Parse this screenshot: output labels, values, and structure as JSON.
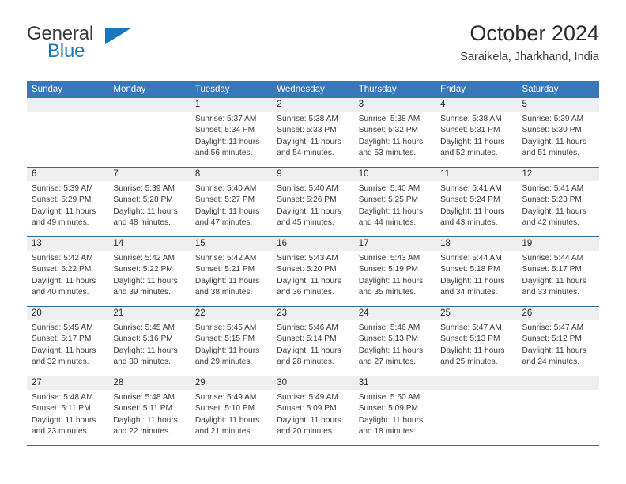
{
  "brand": {
    "name_part1": "General",
    "name_part2": "Blue",
    "flag_icon": "triangle-flag-icon",
    "accent_color": "#1878be",
    "text_color": "#3a3a3a"
  },
  "header": {
    "month_title": "October 2024",
    "location": "Saraikela, Jharkhand, India"
  },
  "calendar": {
    "header_color": "#3878b8",
    "separator_color": "#2e6da4",
    "day_band_color": "#efefef",
    "weekdays": [
      "Sunday",
      "Monday",
      "Tuesday",
      "Wednesday",
      "Thursday",
      "Friday",
      "Saturday"
    ],
    "weeks": [
      [
        {
          "day": "",
          "lines": []
        },
        {
          "day": "",
          "lines": []
        },
        {
          "day": "1",
          "lines": [
            "Sunrise: 5:37 AM",
            "Sunset: 5:34 PM",
            "Daylight: 11 hours",
            "and 56 minutes."
          ]
        },
        {
          "day": "2",
          "lines": [
            "Sunrise: 5:38 AM",
            "Sunset: 5:33 PM",
            "Daylight: 11 hours",
            "and 54 minutes."
          ]
        },
        {
          "day": "3",
          "lines": [
            "Sunrise: 5:38 AM",
            "Sunset: 5:32 PM",
            "Daylight: 11 hours",
            "and 53 minutes."
          ]
        },
        {
          "day": "4",
          "lines": [
            "Sunrise: 5:38 AM",
            "Sunset: 5:31 PM",
            "Daylight: 11 hours",
            "and 52 minutes."
          ]
        },
        {
          "day": "5",
          "lines": [
            "Sunrise: 5:39 AM",
            "Sunset: 5:30 PM",
            "Daylight: 11 hours",
            "and 51 minutes."
          ]
        }
      ],
      [
        {
          "day": "6",
          "lines": [
            "Sunrise: 5:39 AM",
            "Sunset: 5:29 PM",
            "Daylight: 11 hours",
            "and 49 minutes."
          ]
        },
        {
          "day": "7",
          "lines": [
            "Sunrise: 5:39 AM",
            "Sunset: 5:28 PM",
            "Daylight: 11 hours",
            "and 48 minutes."
          ]
        },
        {
          "day": "8",
          "lines": [
            "Sunrise: 5:40 AM",
            "Sunset: 5:27 PM",
            "Daylight: 11 hours",
            "and 47 minutes."
          ]
        },
        {
          "day": "9",
          "lines": [
            "Sunrise: 5:40 AM",
            "Sunset: 5:26 PM",
            "Daylight: 11 hours",
            "and 45 minutes."
          ]
        },
        {
          "day": "10",
          "lines": [
            "Sunrise: 5:40 AM",
            "Sunset: 5:25 PM",
            "Daylight: 11 hours",
            "and 44 minutes."
          ]
        },
        {
          "day": "11",
          "lines": [
            "Sunrise: 5:41 AM",
            "Sunset: 5:24 PM",
            "Daylight: 11 hours",
            "and 43 minutes."
          ]
        },
        {
          "day": "12",
          "lines": [
            "Sunrise: 5:41 AM",
            "Sunset: 5:23 PM",
            "Daylight: 11 hours",
            "and 42 minutes."
          ]
        }
      ],
      [
        {
          "day": "13",
          "lines": [
            "Sunrise: 5:42 AM",
            "Sunset: 5:22 PM",
            "Daylight: 11 hours",
            "and 40 minutes."
          ]
        },
        {
          "day": "14",
          "lines": [
            "Sunrise: 5:42 AM",
            "Sunset: 5:22 PM",
            "Daylight: 11 hours",
            "and 39 minutes."
          ]
        },
        {
          "day": "15",
          "lines": [
            "Sunrise: 5:42 AM",
            "Sunset: 5:21 PM",
            "Daylight: 11 hours",
            "and 38 minutes."
          ]
        },
        {
          "day": "16",
          "lines": [
            "Sunrise: 5:43 AM",
            "Sunset: 5:20 PM",
            "Daylight: 11 hours",
            "and 36 minutes."
          ]
        },
        {
          "day": "17",
          "lines": [
            "Sunrise: 5:43 AM",
            "Sunset: 5:19 PM",
            "Daylight: 11 hours",
            "and 35 minutes."
          ]
        },
        {
          "day": "18",
          "lines": [
            "Sunrise: 5:44 AM",
            "Sunset: 5:18 PM",
            "Daylight: 11 hours",
            "and 34 minutes."
          ]
        },
        {
          "day": "19",
          "lines": [
            "Sunrise: 5:44 AM",
            "Sunset: 5:17 PM",
            "Daylight: 11 hours",
            "and 33 minutes."
          ]
        }
      ],
      [
        {
          "day": "20",
          "lines": [
            "Sunrise: 5:45 AM",
            "Sunset: 5:17 PM",
            "Daylight: 11 hours",
            "and 32 minutes."
          ]
        },
        {
          "day": "21",
          "lines": [
            "Sunrise: 5:45 AM",
            "Sunset: 5:16 PM",
            "Daylight: 11 hours",
            "and 30 minutes."
          ]
        },
        {
          "day": "22",
          "lines": [
            "Sunrise: 5:45 AM",
            "Sunset: 5:15 PM",
            "Daylight: 11 hours",
            "and 29 minutes."
          ]
        },
        {
          "day": "23",
          "lines": [
            "Sunrise: 5:46 AM",
            "Sunset: 5:14 PM",
            "Daylight: 11 hours",
            "and 28 minutes."
          ]
        },
        {
          "day": "24",
          "lines": [
            "Sunrise: 5:46 AM",
            "Sunset: 5:13 PM",
            "Daylight: 11 hours",
            "and 27 minutes."
          ]
        },
        {
          "day": "25",
          "lines": [
            "Sunrise: 5:47 AM",
            "Sunset: 5:13 PM",
            "Daylight: 11 hours",
            "and 25 minutes."
          ]
        },
        {
          "day": "26",
          "lines": [
            "Sunrise: 5:47 AM",
            "Sunset: 5:12 PM",
            "Daylight: 11 hours",
            "and 24 minutes."
          ]
        }
      ],
      [
        {
          "day": "27",
          "lines": [
            "Sunrise: 5:48 AM",
            "Sunset: 5:11 PM",
            "Daylight: 11 hours",
            "and 23 minutes."
          ]
        },
        {
          "day": "28",
          "lines": [
            "Sunrise: 5:48 AM",
            "Sunset: 5:11 PM",
            "Daylight: 11 hours",
            "and 22 minutes."
          ]
        },
        {
          "day": "29",
          "lines": [
            "Sunrise: 5:49 AM",
            "Sunset: 5:10 PM",
            "Daylight: 11 hours",
            "and 21 minutes."
          ]
        },
        {
          "day": "30",
          "lines": [
            "Sunrise: 5:49 AM",
            "Sunset: 5:09 PM",
            "Daylight: 11 hours",
            "and 20 minutes."
          ]
        },
        {
          "day": "31",
          "lines": [
            "Sunrise: 5:50 AM",
            "Sunset: 5:09 PM",
            "Daylight: 11 hours",
            "and 18 minutes."
          ]
        },
        {
          "day": "",
          "lines": []
        },
        {
          "day": "",
          "lines": []
        }
      ]
    ]
  }
}
